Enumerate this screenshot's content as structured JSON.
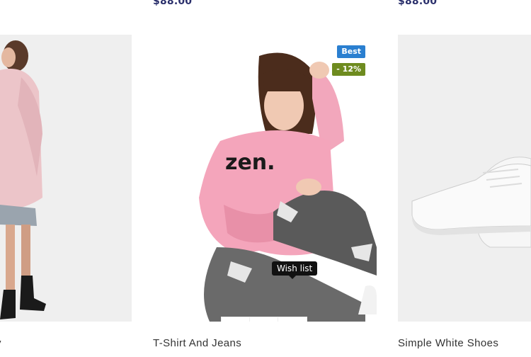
{
  "products": [
    {
      "title": "y",
      "price": ""
    },
    {
      "title": "T-Shirt And Jeans",
      "price": "$88.00",
      "badges": [
        {
          "label": "Best",
          "color": "#2a7fd0"
        },
        {
          "label": "- 12%",
          "color": "#6e8b1f"
        }
      ]
    },
    {
      "title": "Simple White Shoes",
      "price": "$88.00"
    }
  ],
  "actions": {
    "tooltip": "Wish list"
  },
  "colors": {
    "price": "#2a2f6b",
    "badge_best": "#2a7fd0",
    "badge_discount": "#6e8b1f",
    "tooltip_bg": "#111111"
  }
}
